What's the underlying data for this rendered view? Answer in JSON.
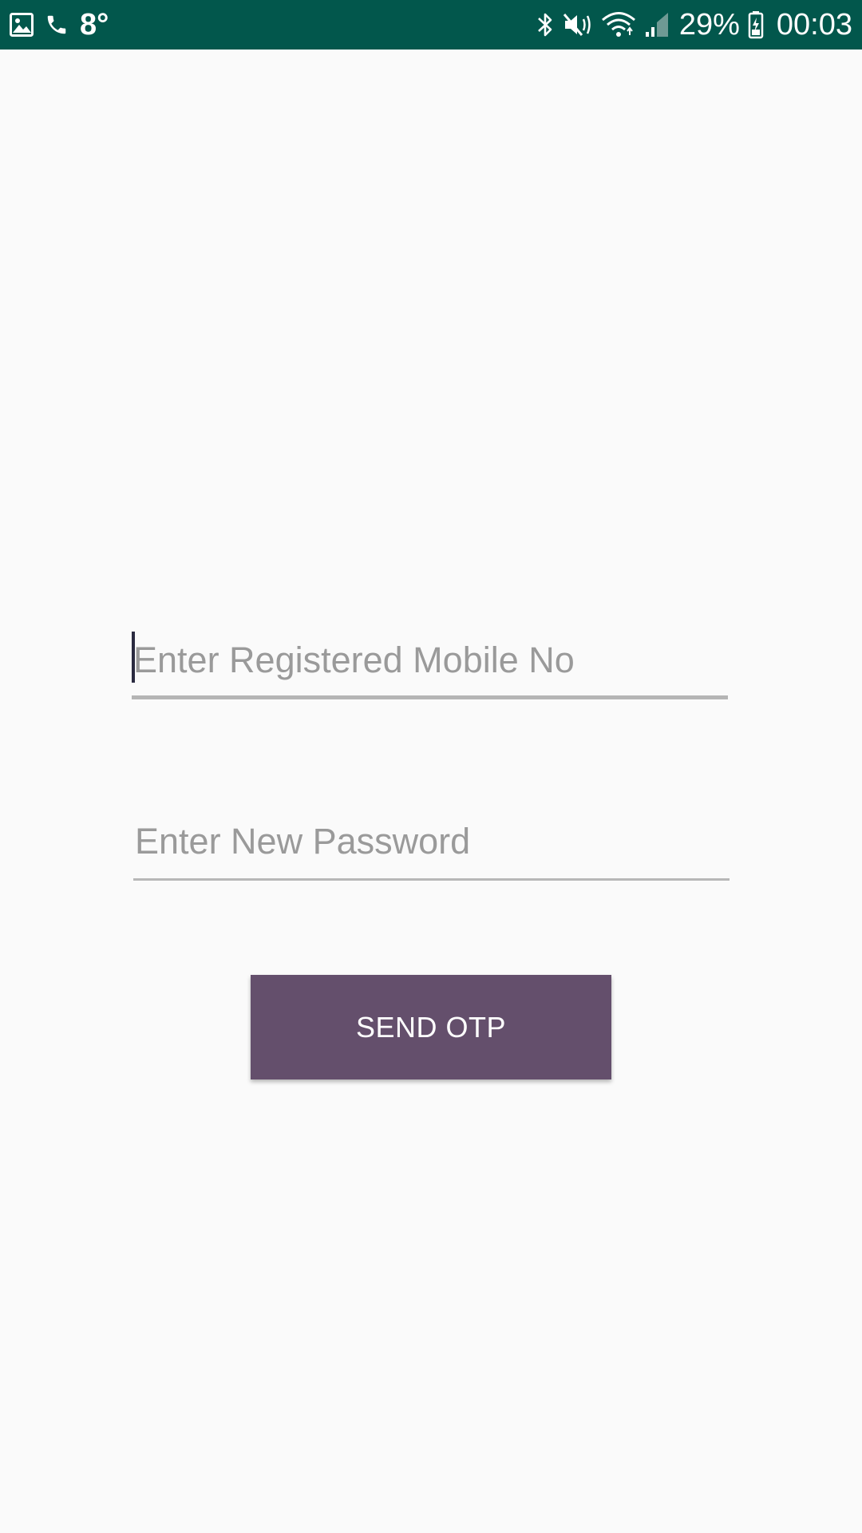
{
  "status_bar": {
    "left_icons": [
      "gallery-icon",
      "phone-icon"
    ],
    "temperature": "8°",
    "right_icons": [
      "bluetooth-icon",
      "mute-icon",
      "wifi-icon",
      "signal-icon"
    ],
    "battery_percent": "29%",
    "time": "00:03",
    "background_color": "#02574c"
  },
  "form": {
    "mobile_field": {
      "placeholder": "Enter Registered Mobile No",
      "value": ""
    },
    "password_field": {
      "placeholder": "Enter New Password",
      "value": ""
    },
    "send_otp_button": {
      "label": "SEND OTP",
      "color": "#644f6c"
    }
  }
}
